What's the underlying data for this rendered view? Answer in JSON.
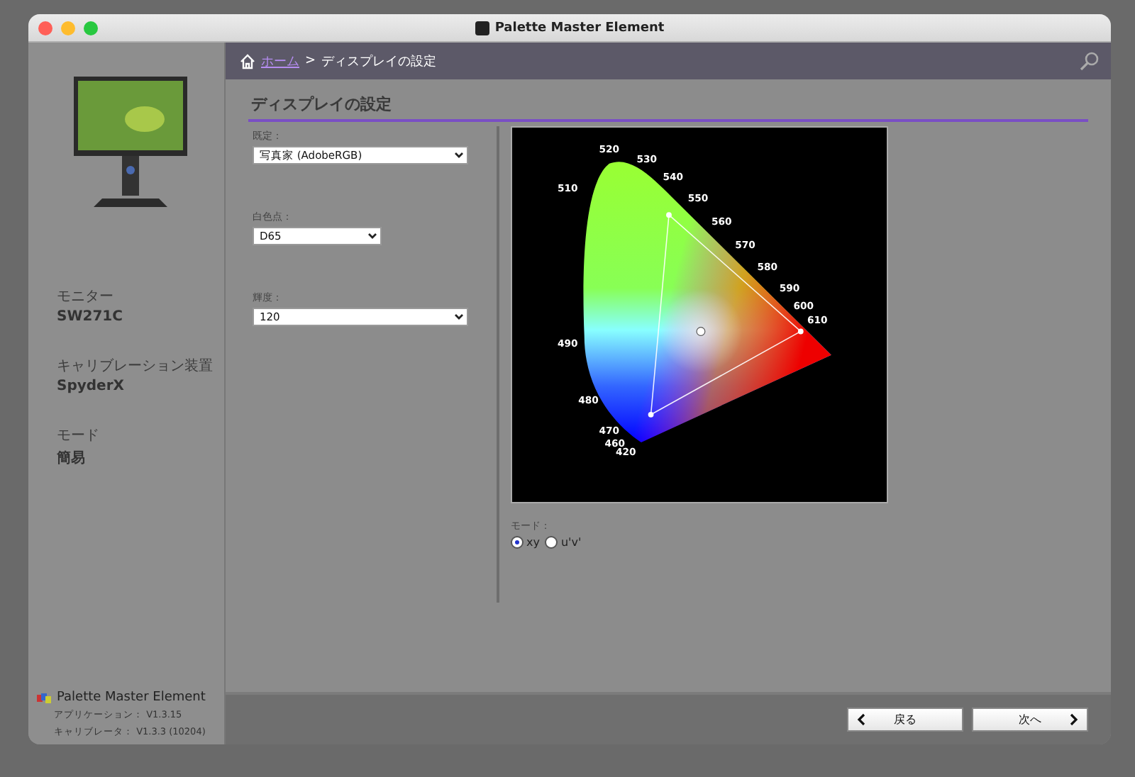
{
  "window": {
    "title": "Palette Master Element"
  },
  "breadcrumb": {
    "home": "ホーム",
    "separator": ">",
    "current": "ディスプレイの設定"
  },
  "sidebar": {
    "info": [
      {
        "label": "モニター",
        "value": "SW271C"
      },
      {
        "label": "キャリブレーション装置",
        "value": "SpyderX"
      },
      {
        "label": "モード",
        "value": "簡易"
      }
    ],
    "footer": {
      "app_name": "Palette Master Element",
      "versions": [
        "アプリケーション： V1.3.15",
        "キャリブレータ： V1.3.3 (10204)"
      ]
    }
  },
  "section_title": "ディスプレイの設定",
  "settings": [
    {
      "label": "既定：",
      "value": "写真家 (AdobeRGB)"
    },
    {
      "label": "白色点：",
      "value": "D65"
    },
    {
      "label": "輝度：",
      "value": "120"
    }
  ],
  "diagram": {
    "wavelength_labels": [
      "520",
      "530",
      "540",
      "550",
      "560",
      "570",
      "580",
      "590",
      "600",
      "610",
      "510",
      "490",
      "480",
      "470",
      "460",
      "420"
    ]
  },
  "mode": {
    "label": "モード：",
    "options": [
      {
        "label": "xy",
        "selected": true
      },
      {
        "label": "u'v'",
        "selected": false
      }
    ]
  },
  "buttons": [
    {
      "label": "戻る",
      "kind": "back"
    },
    {
      "label": "次へ",
      "kind": "next"
    }
  ]
}
